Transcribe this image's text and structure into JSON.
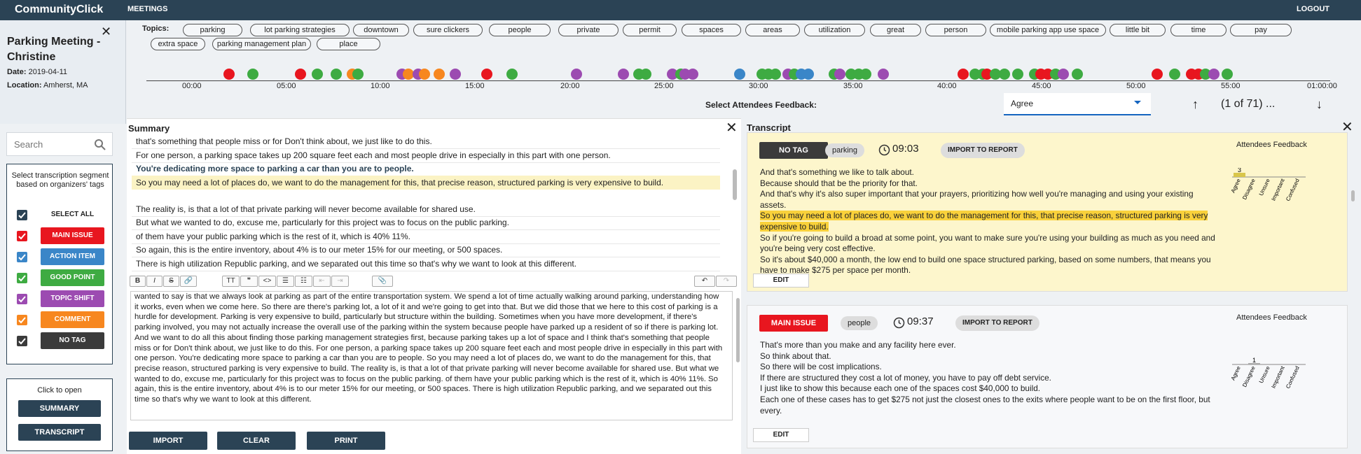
{
  "app": {
    "brand": "CommunityClick",
    "nav_meetings": "MEETINGS",
    "logout": "LOGOUT"
  },
  "meeting": {
    "title": "Parking Meeting - Christine",
    "date_label": "Date:",
    "date": "2019-04-11",
    "location_label": "Location:",
    "location": "Amherst, MA"
  },
  "search": {
    "placeholder": "Search"
  },
  "tag_filter": {
    "intro": "Select transcription segment based on organizers' tags",
    "select_all": "SELECT ALL",
    "tags": [
      {
        "label": "MAIN ISSUE",
        "color": "#e8161f"
      },
      {
        "label": "ACTION ITEM",
        "color": "#3a86c8"
      },
      {
        "label": "GOOD POINT",
        "color": "#3eab42"
      },
      {
        "label": "TOPIC SHIFT",
        "color": "#9c4bb1"
      },
      {
        "label": "COMMENT",
        "color": "#f7871f"
      },
      {
        "label": "NO TAG",
        "color": "#3b3b3b"
      }
    ]
  },
  "open_panel": {
    "label": "Click to open",
    "summary": "SUMMARY",
    "transcript": "TRANSCRIPT"
  },
  "topics": {
    "label": "Topics:",
    "items": [
      "parking",
      "lot parking strategies",
      "downtown",
      "sure clickers",
      "people",
      "private",
      "permit",
      "spaces",
      "areas",
      "utilization",
      "great",
      "person",
      "mobile parking app use space",
      "little bit",
      "time",
      "pay",
      "extra space",
      "parking management plan",
      "place"
    ]
  },
  "timeline": {
    "ticks": [
      "00:00",
      "05:00",
      "10:00",
      "15:00",
      "20:00",
      "25:00",
      "30:00",
      "35:00",
      "40:00",
      "45:00",
      "50:00",
      "55:00",
      "01:00:00"
    ]
  },
  "attendees_feedback": {
    "label": "Select Attendees Feedback:",
    "value": "Agree",
    "count": "(1 of 71) ..."
  },
  "summary": {
    "title": "Summary",
    "rows": [
      "that's something that people miss or for Don't think about, we just like to do this.",
      "For one person, a parking space takes up 200 square feet each and most people drive in especially in this part with one person.",
      "You're dedicating more space to parking a car than you are to people.",
      "So you may need a lot of places do, we want to do the management for this, that precise reason, structured parking is very expensive to build.",
      "The reality is, is that a lot of that private parking will never become available for shared use.",
      "But what we wanted to do, excuse me, particularly for this project was to focus on the public parking.",
      "of them have your public parking which is the rest of it, which is 40% 11%.",
      "So again, this is the entire inventory, about 4% is to our meter 15% for our meeting, or 500 spaces.",
      "There is high utilization Republic parking, and we separated out this time so that's why we want to look at this different."
    ],
    "editor_text": "wanted to say is that we always look at parking as part of the entire transportation system. We spend a lot of time actually walking around parking, understanding how it works, even when we come here. So there are there's parking lot, a lot of it and we're going to get into that. But we did those that we here to this cost of parking is a hurdle for development.  Parking is very expensive to build, particularly but structure within the building.  Sometimes when you have more development, if there's parking involved, you may not actually increase the overall use of the parking within the system because people have parked up a resident of so if there is parking lot. And we want to do all this about finding those parking management strategies first, because parking takes up a lot of space and I think that's something that people miss or for Don't think about, we just like to do this. For one person, a parking space takes up 200 square feet each and most people drive in especially in this part with one person. You're dedicating more space to parking a car than you are to people. So you may need a lot of places do, we want to do the management for this, that precise reason, structured parking is very expensive to build. The reality is, is that a lot of that private parking will never become available for shared use. But what we wanted to do, excuse me, particularly for this project was to focus on the public parking. of them have your public parking which is the rest of it, which is 40% 11%. So again, this is the entire inventory, about 4% is to our meter 15% for our meeting, or 500 spaces. There is high utilization Republic parking, and we separated out this time so that's why we want to look at this different.",
    "buttons": {
      "import": "IMPORT",
      "clear": "CLEAR",
      "print": "PRINT"
    }
  },
  "transcript": {
    "title": "Transcript",
    "cards": [
      {
        "tag": "NO TAG",
        "tag_color": "#3b3b3b",
        "topic": "parking",
        "time": "09:03",
        "import": "IMPORT TO REPORT",
        "lines": [
          "And that's something we like to talk about.",
          "Because should that be the priority for that.",
          "And that's why it's also super important that your prayers, prioritizing how well you're managing and using your existing assets.",
          "So you may need a lot of places do, we want to do the management for this, that precise reason, structured parking is very expensive to build.",
          "So if you're going to build a broad at some point, you want to make sure you're using your building as much as you need and you're being very cost effective.",
          "So it's about $40,000 a month, the low end to build one space structured parking, based on some numbers, that means you have to make $275 per space per month."
        ],
        "feedback_title": "Attendees Feedback",
        "edit": "EDIT"
      },
      {
        "tag": "MAIN ISSUE",
        "tag_color": "#e8161f",
        "topic": "people",
        "time": "09:37",
        "import": "IMPORT TO REPORT",
        "lines": [
          "That's more than you make and any facility here ever.",
          "So think about that.",
          "So there will be cost implications.",
          "If there are structured they cost a lot of money, you have to pay off debt service.",
          "I just like to show this because each one of the spaces cost $40,000 to build.",
          "Each one of these cases has to get $275 not just the closest ones to the exits where people want to be on the first floor, but every."
        ],
        "feedback_title": "Attendees Feedback",
        "edit": "EDIT"
      }
    ]
  },
  "chart_data": [
    {
      "type": "bar",
      "categories": [
        "Agree",
        "Disagree",
        "Unsure",
        "Important",
        "Confused"
      ],
      "values": [
        3,
        0,
        0,
        0,
        0
      ],
      "data_labels": [
        "3"
      ],
      "color": "#d9c64a"
    },
    {
      "type": "bar",
      "categories": [
        "Agree",
        "Disagree",
        "Unsure",
        "Important",
        "Confused"
      ],
      "values": [
        0,
        1,
        0,
        0,
        0
      ],
      "data_labels": [
        "1"
      ],
      "color": "#aaaaaa"
    }
  ]
}
